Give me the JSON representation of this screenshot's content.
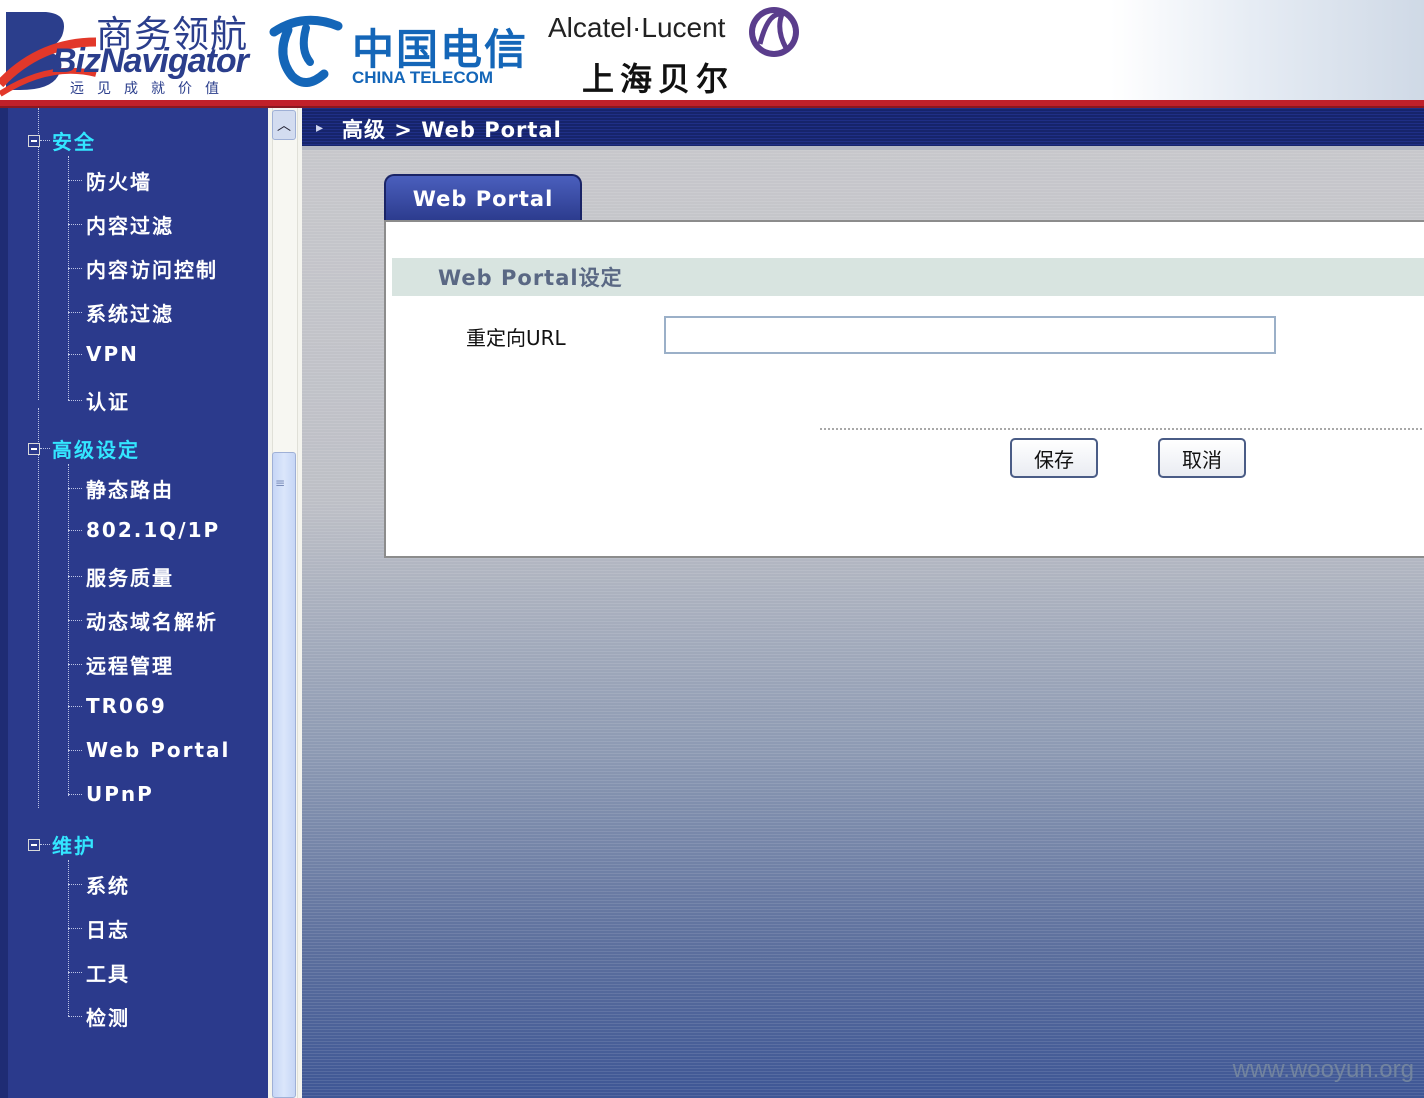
{
  "header": {
    "biz_cn": "商务领航",
    "biz_en": "BizNavigator",
    "biz_tagline": "远见成就价值",
    "telecom_cn": "中国电信",
    "telecom_en": "CHINA TELECOM",
    "alcatel_en": "Alcatel·Lucent",
    "alcatel_cn": "上海贝尔"
  },
  "sidebar": {
    "groups": [
      {
        "label": "安全",
        "items": [
          "防火墙",
          "内容过滤",
          "内容访问控制",
          "系统过滤",
          "VPN",
          "认证"
        ]
      },
      {
        "label": "高级设定",
        "items": [
          "静态路由",
          "802.1Q/1P",
          "服务质量",
          "动态域名解析",
          "远程管理",
          "TR069",
          "Web Portal",
          "UPnP"
        ]
      },
      {
        "label": "维护",
        "items": [
          "系统",
          "日志",
          "工具",
          "检测"
        ]
      }
    ]
  },
  "breadcrumb": "高级 > Web Portal",
  "tab_label": "Web Portal",
  "section_title": "Web Portal设定",
  "form": {
    "redirect_label": "重定向URL",
    "redirect_value": ""
  },
  "buttons": {
    "save": "保存",
    "cancel": "取消"
  },
  "watermark": "www.wooyun.org",
  "colors": {
    "sidebar_bg": "#2b3a8c",
    "group_label": "#33e6ff",
    "header_red": "#c0202a"
  }
}
